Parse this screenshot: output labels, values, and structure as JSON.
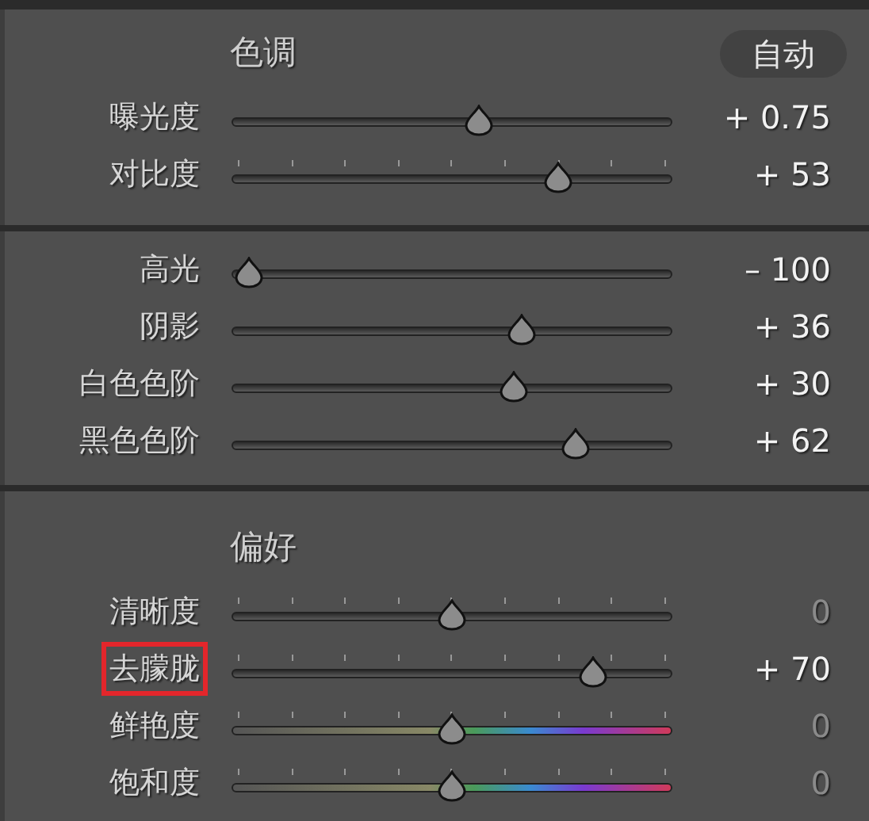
{
  "sections": [
    {
      "title": "色调",
      "auto_button": "自动",
      "sliders": [
        {
          "label": "曝光度",
          "level": 0.56,
          "reading": "+ 0.75",
          "kind": "plain",
          "ticks": false,
          "dim": false,
          "highlighted": false
        },
        {
          "label": "对比度",
          "level": 0.74,
          "reading": "+ 53",
          "kind": "plain",
          "ticks": true,
          "dim": false,
          "highlighted": false
        }
      ]
    },
    {
      "sliders": [
        {
          "label": "高光",
          "level": 0.04,
          "reading": "– 100",
          "kind": "plain",
          "ticks": false,
          "dim": false,
          "highlighted": false
        },
        {
          "label": "阴影",
          "level": 0.66,
          "reading": "+ 36",
          "kind": "plain",
          "ticks": false,
          "dim": false,
          "highlighted": false
        },
        {
          "label": "白色色阶",
          "level": 0.64,
          "reading": "+ 30",
          "kind": "plain",
          "ticks": false,
          "dim": false,
          "highlighted": false
        },
        {
          "label": "黑色色阶",
          "level": 0.78,
          "reading": "+ 62",
          "kind": "plain",
          "ticks": false,
          "dim": false,
          "highlighted": false
        }
      ]
    },
    {
      "title": "偏好",
      "sliders": [
        {
          "label": "清晰度",
          "level": 0.5,
          "reading": "0",
          "kind": "plain",
          "ticks": true,
          "dim": true,
          "highlighted": false
        },
        {
          "label": "去朦胧",
          "level": 0.82,
          "reading": "+ 70",
          "kind": "plain",
          "ticks": true,
          "dim": false,
          "highlighted": true
        },
        {
          "label": "鲜艳度",
          "level": 0.5,
          "reading": "0",
          "kind": "color",
          "ticks": true,
          "dim": true,
          "highlighted": false
        },
        {
          "label": "饱和度",
          "level": 0.5,
          "reading": "0",
          "kind": "color",
          "ticks": true,
          "dim": true,
          "highlighted": false
        }
      ]
    }
  ]
}
